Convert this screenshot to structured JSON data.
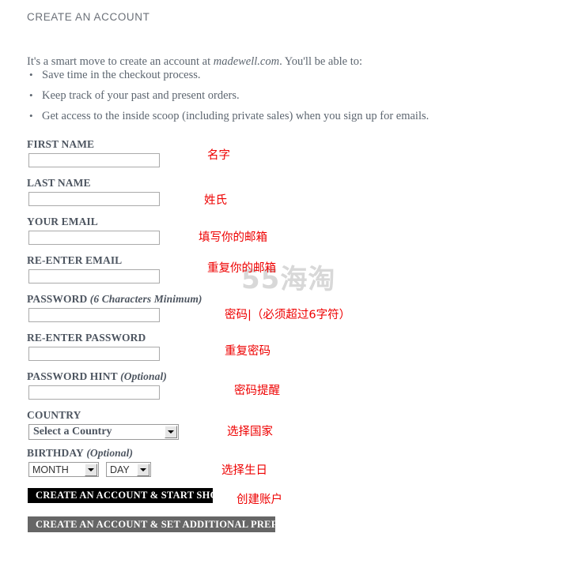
{
  "page": {
    "title": "CREATE AN ACCOUNT",
    "watermark": "55海淘"
  },
  "intro": {
    "lead_before": "It's a smart move to create an account at ",
    "site_name": "madewell.com",
    "lead_after": ". You'll be able to:",
    "benefits": [
      "Save time in the checkout process.",
      "Keep track of your past and present orders.",
      "Get access to the inside scoop (including private sales) when you sign up for emails."
    ]
  },
  "form": {
    "fields": [
      {
        "label": "FIRST NAME",
        "suffix": "",
        "value": "",
        "placeholder": ""
      },
      {
        "label": "LAST NAME",
        "suffix": "",
        "value": "",
        "placeholder": ""
      },
      {
        "label": "YOUR EMAIL",
        "suffix": "",
        "value": "",
        "placeholder": ""
      },
      {
        "label": "RE-ENTER EMAIL",
        "suffix": "",
        "value": "",
        "placeholder": ""
      },
      {
        "label": "PASSWORD",
        "suffix": " (6 Characters Minimum)",
        "value": "",
        "placeholder": ""
      },
      {
        "label": "RE-ENTER PASSWORD",
        "suffix": "",
        "value": "",
        "placeholder": ""
      },
      {
        "label": "PASSWORD HINT",
        "suffix": " (Optional)",
        "value": "",
        "placeholder": ""
      }
    ],
    "country": {
      "label": "COUNTRY",
      "selected": "Select a Country"
    },
    "birthday": {
      "label": "BIRTHDAY",
      "suffix": " (Optional)",
      "month_selected": "MONTH",
      "day_selected": "DAY"
    }
  },
  "buttons": {
    "primary": "CREATE AN ACCOUNT & START SHOPPING",
    "secondary": "CREATE AN ACCOUNT & SET ADDITIONAL PREFERENCES"
  },
  "annotations": [
    {
      "text": "名字"
    },
    {
      "text": "姓氏"
    },
    {
      "text": "填写你的邮箱"
    },
    {
      "text": "重复你的邮箱"
    },
    {
      "text": "密码|（必须超过6字符）"
    },
    {
      "text": "重复密码"
    },
    {
      "text": "密码提醒"
    },
    {
      "text": "选择国家"
    },
    {
      "text": "选择生日"
    },
    {
      "text": "创建账户"
    }
  ],
  "colors": {
    "annotation_red": "#ee0000",
    "primary_button_bg": "#000000",
    "secondary_button_bg": "#666666",
    "label_text": "#4d5560",
    "body_text": "#5d6670",
    "watermark": "#d8d8d8"
  }
}
